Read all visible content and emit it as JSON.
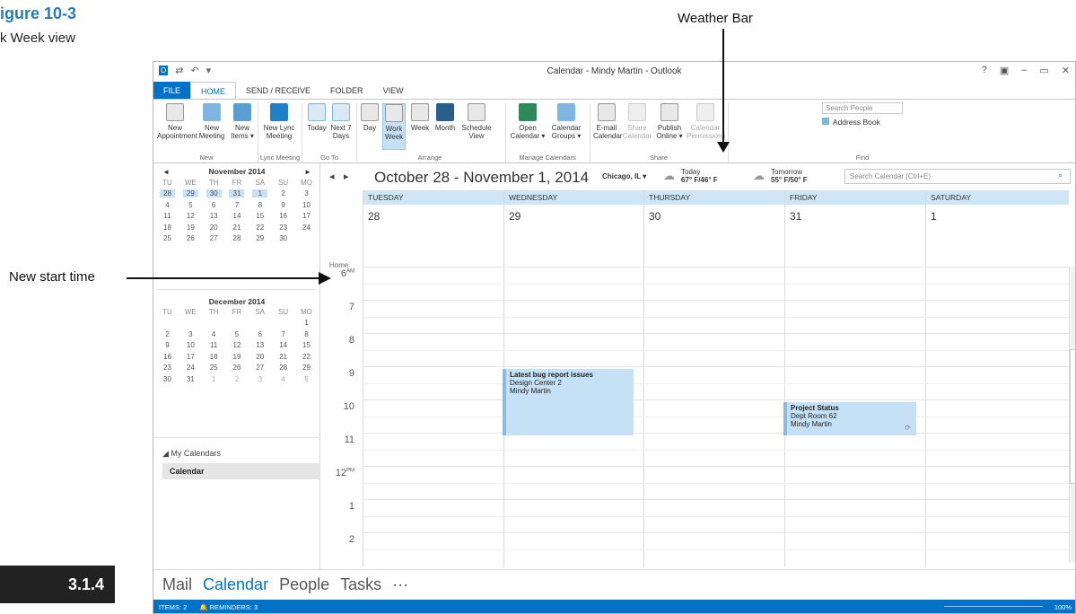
{
  "figure": {
    "label": "igure 10-3",
    "caption": "k Week view",
    "objective_badge": "3.1.4"
  },
  "callouts": {
    "weather_bar": "Weather Bar",
    "new_start_time": "New start time"
  },
  "window": {
    "title": "Calendar - Mindy Martin - Outlook",
    "controls": [
      "?",
      "▣",
      "–",
      "▭",
      "✕"
    ]
  },
  "tabs": [
    "FILE",
    "HOME",
    "SEND / RECEIVE",
    "FOLDER",
    "VIEW"
  ],
  "ribbon": {
    "buttons": {
      "new_appt": "New Appointment",
      "new_meeting": "New Meeting",
      "new_items": "New Items ▾",
      "new_lync": "New Lync Meeting",
      "today": "Today",
      "next7": "Next 7 Days",
      "day": "Day",
      "work_week": "Work Week",
      "week": "Week",
      "month": "Month",
      "schedule": "Schedule View",
      "open_cal": "Open Calendar ▾",
      "cal_groups": "Calendar Groups ▾",
      "email_cal": "E-mail Calendar",
      "share_cal": "Share Calendar",
      "publish": "Publish Online ▾",
      "permissions": "Calendar Permissions"
    },
    "groups": {
      "new": "New",
      "lync": "Lync Meeting",
      "goto": "Go To",
      "arrange": "Arrange",
      "manage": "Manage Calendars",
      "share": "Share",
      "find": "Find"
    },
    "search_people": "Search People",
    "address_book": "Address Book"
  },
  "mini_cal_nov": {
    "title": "November 2014",
    "dow": [
      "TU",
      "WE",
      "TH",
      "FR",
      "SA",
      "SU",
      "MO"
    ],
    "rows": [
      [
        "28",
        "29",
        "30",
        "31",
        "1",
        "2",
        "3"
      ],
      [
        "4",
        "5",
        "6",
        "7",
        "8",
        "9",
        "10"
      ],
      [
        "11",
        "12",
        "13",
        "14",
        "15",
        "16",
        "17"
      ],
      [
        "18",
        "19",
        "20",
        "21",
        "22",
        "23",
        "24"
      ],
      [
        "25",
        "26",
        "27",
        "28",
        "29",
        "30",
        ""
      ]
    ]
  },
  "mini_cal_dec": {
    "title": "December 2014",
    "dow": [
      "TU",
      "WE",
      "TH",
      "FR",
      "SA",
      "SU",
      "MO"
    ],
    "rows": [
      [
        "",
        "",
        "",
        "",
        "",
        "",
        "1"
      ],
      [
        "2",
        "3",
        "4",
        "5",
        "6",
        "7",
        "8"
      ],
      [
        "9",
        "10",
        "11",
        "12",
        "13",
        "14",
        "15"
      ],
      [
        "16",
        "17",
        "18",
        "19",
        "20",
        "21",
        "22"
      ],
      [
        "23",
        "24",
        "25",
        "26",
        "27",
        "28",
        "29"
      ],
      [
        "30",
        "31",
        "1",
        "2",
        "3",
        "4",
        "5"
      ]
    ]
  },
  "my_calendars": {
    "header": "◢ My Calendars",
    "item": "Calendar"
  },
  "calendar": {
    "date_range": "October 28 - November 1, 2014",
    "location": "Chicago, IL ▾",
    "today_label": "Today",
    "today_temp": "67° F/46° F",
    "tomorrow_label": "Tomorrow",
    "tomorrow_temp": "55° F/50° F",
    "search_placeholder": "Search Calendar (Ctrl+E)",
    "home_label": "Home",
    "days": [
      {
        "name": "TUESDAY",
        "num": "28"
      },
      {
        "name": "WEDNESDAY",
        "num": "29"
      },
      {
        "name": "THURSDAY",
        "num": "30"
      },
      {
        "name": "FRIDAY",
        "num": "31"
      },
      {
        "name": "SATURDAY",
        "num": "1"
      }
    ],
    "hours": [
      {
        "h": "6",
        "ampm": "AM"
      },
      {
        "h": "7",
        "ampm": ""
      },
      {
        "h": "8",
        "ampm": ""
      },
      {
        "h": "9",
        "ampm": ""
      },
      {
        "h": "10",
        "ampm": ""
      },
      {
        "h": "11",
        "ampm": ""
      },
      {
        "h": "12",
        "ampm": "PM"
      },
      {
        "h": "1",
        "ampm": ""
      },
      {
        "h": "2",
        "ampm": ""
      }
    ],
    "appointments": [
      {
        "title": "Latest bug report issues",
        "location": "Design Center 2",
        "organizer": "Mindy Martin"
      },
      {
        "title": "Project Status",
        "location": "Dept Room 62",
        "organizer": "Mindy Martin"
      }
    ]
  },
  "bottom_nav": [
    "Mail",
    "Calendar",
    "People",
    "Tasks",
    "···"
  ],
  "status": {
    "items": "ITEMS: 2",
    "reminders": "🔔 REMINDERS: 3",
    "zoom": "100%"
  }
}
